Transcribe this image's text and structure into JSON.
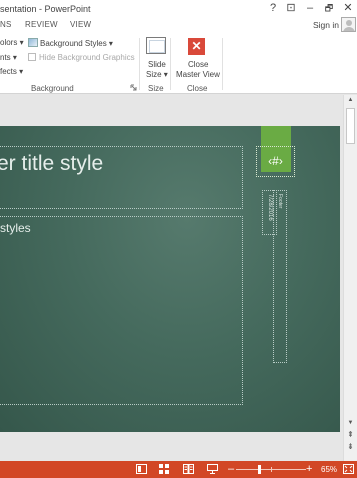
{
  "window": {
    "title": "sentation - PowerPoint",
    "help": "?",
    "restore_ribbon": "⊡",
    "minimize": "–",
    "maximize": "🗗",
    "close": "✕"
  },
  "tabs": [
    {
      "label": "NS"
    },
    {
      "label": "REVIEW"
    },
    {
      "label": "VIEW"
    }
  ],
  "signin": "Sign in",
  "ribbon": {
    "colors": "olors ▾",
    "fonts": "nts ▾",
    "effects": "fects ▾",
    "background_styles": "Background Styles ▾",
    "hide_bg_graphics": "Hide Background Graphics",
    "slide_size_line1": "Slide",
    "slide_size_line2": "Size ▾",
    "close_line1": "Close",
    "close_line2": "Master View",
    "group_background": "Background",
    "group_size": "Size",
    "group_close": "Close",
    "close_icon": "✕"
  },
  "slide": {
    "title_text": "er title style",
    "body_text": " styles",
    "number_text": "‹#›",
    "date_text": "7/28/2016",
    "date_label": "Footer"
  },
  "scrollbar": {
    "up": "▲",
    "down": "▼",
    "prev": "⇞",
    "next": "⇟"
  },
  "status": {
    "zoom_minus": "–",
    "zoom_plus": "+",
    "zoom_level": "65%",
    "accent_color": "#d24726"
  }
}
